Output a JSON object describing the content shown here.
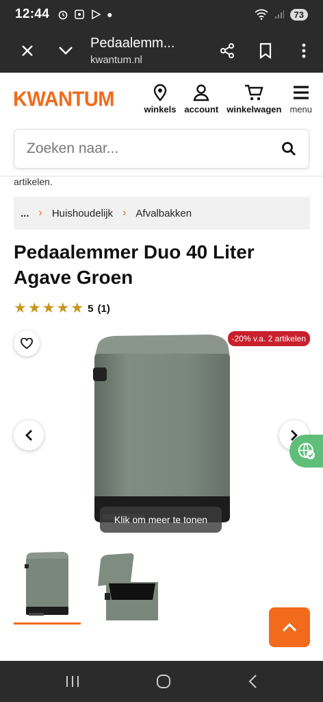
{
  "status_bar": {
    "time": "12:44",
    "battery": "73"
  },
  "browser": {
    "page_title": "Pedaalemm...",
    "domain": "kwantum.nl"
  },
  "header": {
    "logo": "KWANTUM",
    "nav": [
      {
        "label": "winkels",
        "icon": "map-pin-icon"
      },
      {
        "label": "account",
        "icon": "user-icon"
      },
      {
        "label": "winkelwagen",
        "icon": "cart-icon"
      },
      {
        "label": "menu",
        "icon": "hamburger-icon"
      }
    ]
  },
  "search": {
    "placeholder": "Zoeken naar..."
  },
  "notice_fragment": "artikelen.",
  "breadcrumb": {
    "ellipsis": "...",
    "items": [
      "Huishoudelijk",
      "Afvalbakken"
    ]
  },
  "product": {
    "title": "Pedaalemmer Duo 40 Liter Agave Groen",
    "rating": {
      "stars": 5,
      "score": "5",
      "count": "(1)"
    },
    "promo_badge": "-20% v.a. 2 artikelen",
    "gallery_hint": "Klik om meer te tonen",
    "image_count": 2
  },
  "colors": {
    "brand": "#f26a1b",
    "promo": "#c8202d",
    "bin": "#7f8c82",
    "star": "#c8961f"
  }
}
